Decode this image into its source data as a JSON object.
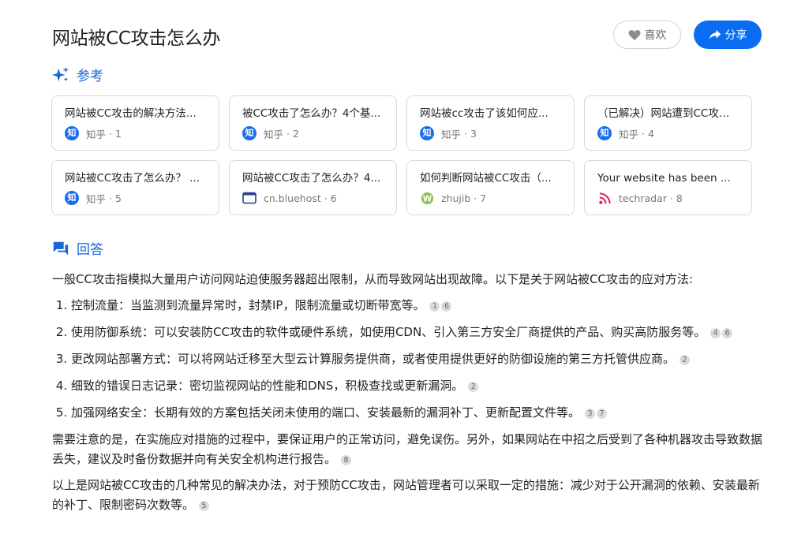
{
  "page": {
    "title": "网站被CC攻击怎么办",
    "like_label": "喜欢",
    "share_label": "分享"
  },
  "references": {
    "heading": "参考",
    "items": [
      {
        "title": "网站被CC攻击的解决方法...",
        "source": "知乎",
        "index": "1",
        "icon": "zhihu-icon"
      },
      {
        "title": "被CC攻击了怎么办？4个基...",
        "source": "知乎",
        "index": "2",
        "icon": "zhihu-icon"
      },
      {
        "title": "网站被cc攻击了该如何应...",
        "source": "知乎",
        "index": "3",
        "icon": "zhihu-icon"
      },
      {
        "title": "（已解决）网站遭到CC攻击...",
        "source": "知乎",
        "index": "4",
        "icon": "zhihu-icon"
      },
      {
        "title": "网站被CC攻击了怎么办？ ...",
        "source": "知乎",
        "index": "5",
        "icon": "zhihu-icon"
      },
      {
        "title": "网站被CC攻击了怎么办？4...",
        "source": "cn.bluehost",
        "index": "6",
        "icon": "bluehost-icon"
      },
      {
        "title": "如何判断网站被CC攻击（...",
        "source": "zhujib",
        "index": "7",
        "icon": "wordpress-icon"
      },
      {
        "title": "Your website has been ...",
        "source": "techradar",
        "index": "8",
        "icon": "rss-icon"
      }
    ]
  },
  "answer": {
    "heading": "回答",
    "intro": "一般CC攻击指模拟大量用户访问网站迫使服务器超出限制，从而导致网站出现故障。以下是关于网站被CC攻击的应对方法:",
    "list": [
      {
        "text": "控制流量：当监测到流量异常时，封禁IP，限制流量或切断带宽等。",
        "cites": [
          "1",
          "6"
        ]
      },
      {
        "text": "使用防御系统：可以安装防CC攻击的软件或硬件系统，如使用CDN、引入第三方安全厂商提供的产品、购买高防服务等。",
        "cites": [
          "4",
          "6"
        ]
      },
      {
        "text": "更改网站部署方式：可以将网站迁移至大型云计算服务提供商，或者使用提供更好的防御设施的第三方托管供应商。",
        "cites": [
          "2"
        ]
      },
      {
        "text": "细致的错误日志记录：密切监视网站的性能和DNS，积极查找或更新漏洞。",
        "cites": [
          "2"
        ]
      },
      {
        "text": "加强网络安全：长期有效的方案包括关闭未使用的端口、安装最新的漏洞补丁、更新配置文件等。",
        "cites": [
          "3",
          "7"
        ]
      }
    ],
    "para2": "需要注意的是，在实施应对措施的过程中，要保证用户的正常访问，避免误伤。另外，如果网站在中招之后受到了各种机器攻击导致数据丢失，建议及时备份数据并向有关安全机构进行报告。",
    "para2_cites": [
      "8"
    ],
    "para3": "以上是网站被CC攻击的几种常见的解决办法，对于预防CC攻击，网站管理者可以采取一定的措施：减少对于公开漏洞的依赖、安装最新的补丁、限制密码次数等。",
    "para3_cites": [
      "5"
    ]
  },
  "colors": {
    "accent": "#0a6cf0",
    "zhihu": "#1a6bf0",
    "heading": "#1a66d6"
  }
}
